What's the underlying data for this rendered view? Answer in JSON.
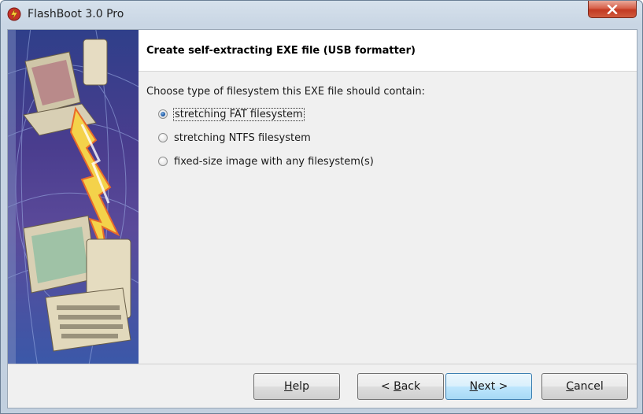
{
  "window": {
    "title": "FlashBoot 3.0 Pro"
  },
  "header": {
    "title": "Create self-extracting EXE file (USB formatter)"
  },
  "main": {
    "prompt": "Choose type of filesystem this EXE file should contain:",
    "options": [
      {
        "label": "stretching FAT filesystem",
        "checked": true
      },
      {
        "label": "stretching NTFS filesystem",
        "checked": false
      },
      {
        "label": "fixed-size image with any filesystem(s)",
        "checked": false
      }
    ]
  },
  "buttons": {
    "help": {
      "pre": "",
      "key": "H",
      "post": "elp"
    },
    "back": {
      "pre": "< ",
      "key": "B",
      "post": "ack"
    },
    "next": {
      "pre": "",
      "key": "N",
      "post": "ext >"
    },
    "cancel": {
      "pre": "",
      "key": "C",
      "post": "ancel"
    }
  },
  "icons": {
    "app": "flashboot-lightning-icon",
    "close": "close-icon"
  },
  "colors": {
    "close_button": "#c23a22",
    "default_button_border": "#3c7fb1"
  }
}
